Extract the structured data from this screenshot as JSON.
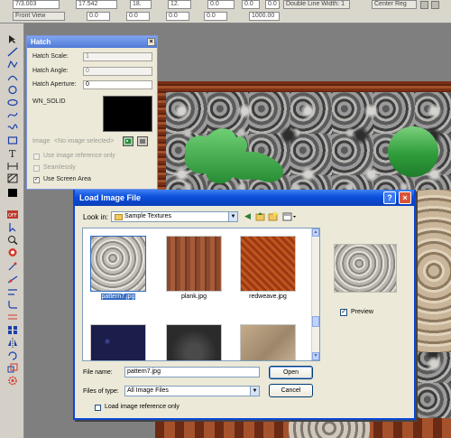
{
  "toolbar": {
    "row1": [
      "7/3.003",
      "17.542",
      "18.",
      "12.",
      "0.0",
      "0.0",
      "0.0",
      "Double Line Width: 1",
      "Center Reg"
    ],
    "row2": [
      "Front View",
      "0.0",
      "0.0",
      "0.0",
      "0.0",
      "1000.00"
    ]
  },
  "hatch_panel": {
    "title": "Hatch",
    "close": "×",
    "scale_label": "Hatch Scale:",
    "scale_value": "1",
    "angle_label": "Hatch Angle:",
    "angle_value": "0",
    "aperture_label": "Hatch Aperture:",
    "aperture_value": "0",
    "pattern_name": "WN_SOLID",
    "image_label": "Image",
    "image_value": "<No image selected>",
    "options": [
      {
        "label": "Use image reference only",
        "checked": false,
        "enabled": false
      },
      {
        "label": "Seamlessly",
        "checked": false,
        "enabled": false
      },
      {
        "label": "Use Screen Area",
        "checked": true,
        "enabled": true
      }
    ]
  },
  "dialog": {
    "title": "Load Image File",
    "help": "?",
    "close": "×",
    "look_in_label": "Look in:",
    "look_in_value": "Sample Textures",
    "files": [
      {
        "name": "pattern7.jpg",
        "selected": true
      },
      {
        "name": "plank.jpg",
        "selected": false
      },
      {
        "name": "redweave.jpg",
        "selected": false
      },
      {
        "name": "",
        "selected": false
      },
      {
        "name": "",
        "selected": false
      },
      {
        "name": "",
        "selected": false
      }
    ],
    "preview_label": "Preview",
    "preview_checked": true,
    "file_name_label": "File name:",
    "file_name_value": "pattern7.jpg",
    "file_type_label": "Files of type:",
    "file_type_value": "All Image Files",
    "open_label": "Open",
    "cancel_label": "Cancel",
    "reference_label": "Load image reference only"
  }
}
